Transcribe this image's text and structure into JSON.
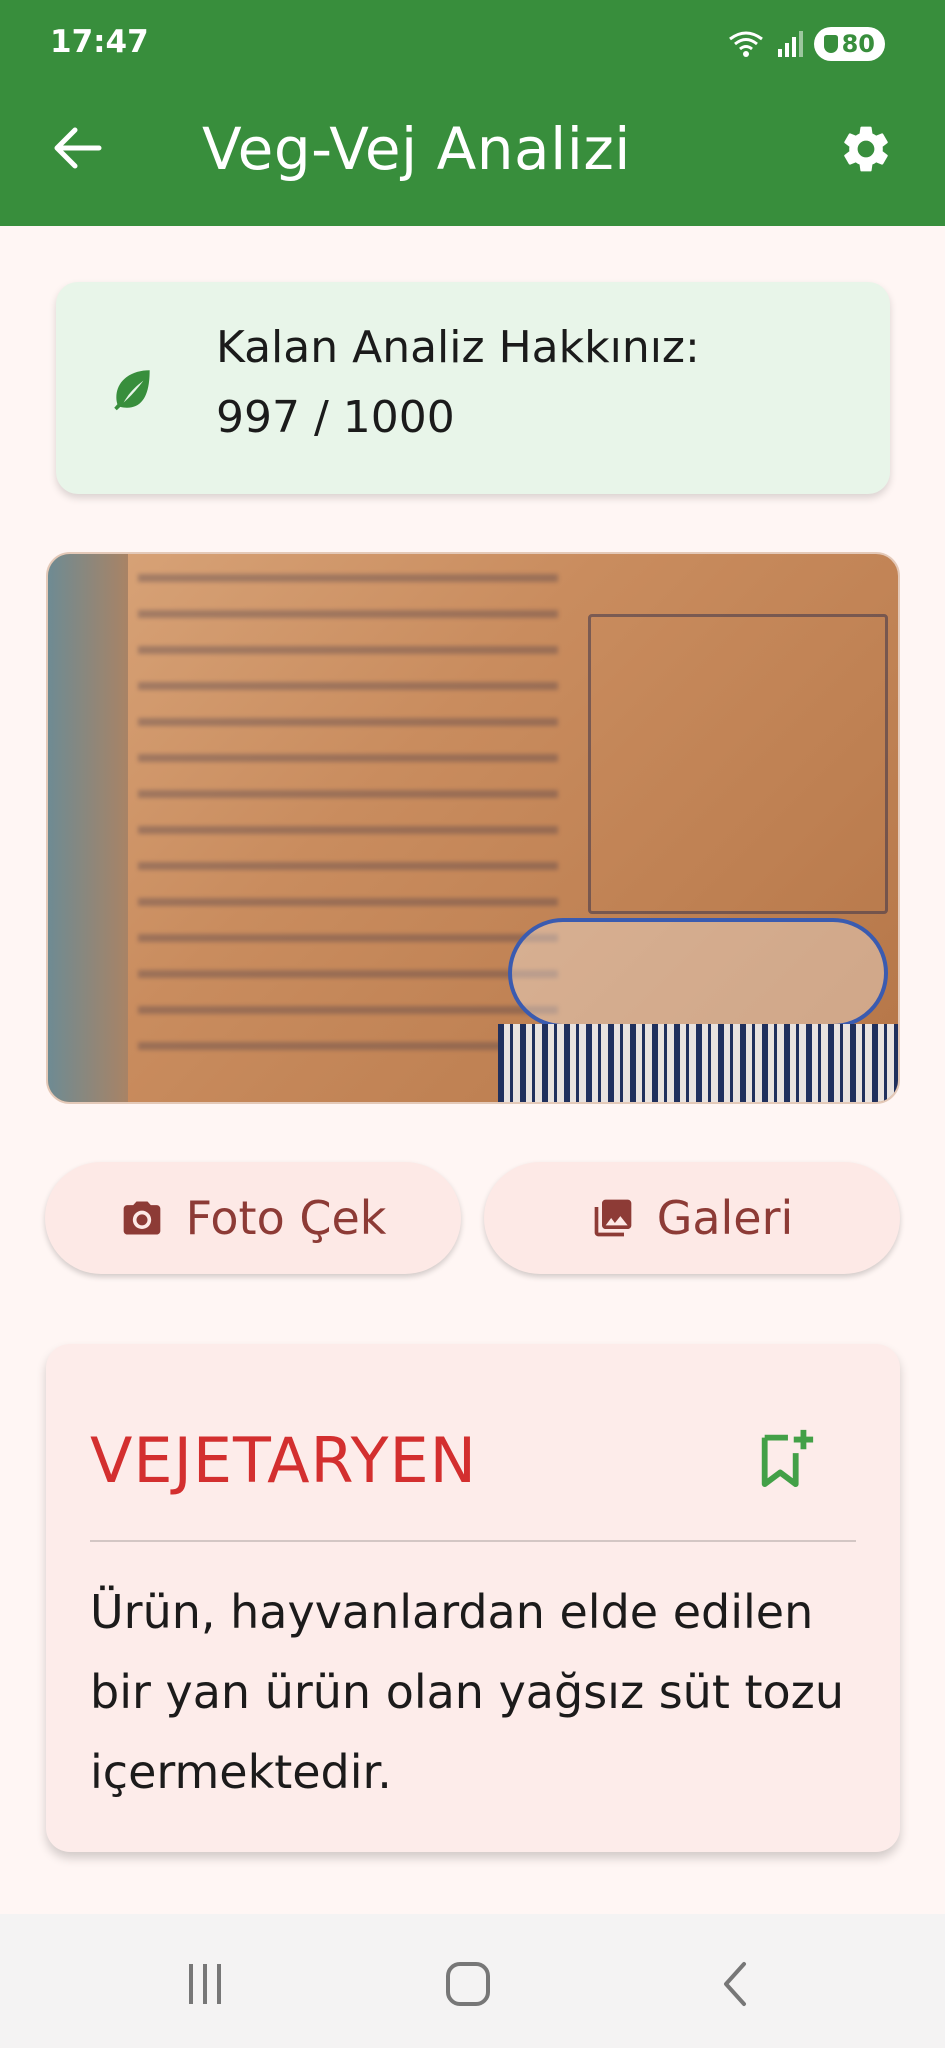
{
  "status_bar": {
    "time": "17:47",
    "battery": "80"
  },
  "app_bar": {
    "title": "Veg-Vej Analizi",
    "back_icon": "arrow-back-icon",
    "settings_icon": "gear-icon"
  },
  "quota": {
    "label": "Kalan Analiz Hakkınız:",
    "value": "997 / 1000",
    "icon": "leaf-icon"
  },
  "actions": {
    "photo_label": "Foto Çek",
    "gallery_label": "Galeri"
  },
  "result": {
    "title": "VEJETARYEN",
    "description": "Ürün, hayvanlardan elde edilen bir yan ürün olan yağsız süt tozu içermektedir."
  },
  "colors": {
    "primary_green": "#388e3c",
    "quota_bg": "#e8f5e9",
    "result_title": "#d32f2f",
    "button_text": "#8d3b36",
    "page_bg": "#fff6f4"
  }
}
